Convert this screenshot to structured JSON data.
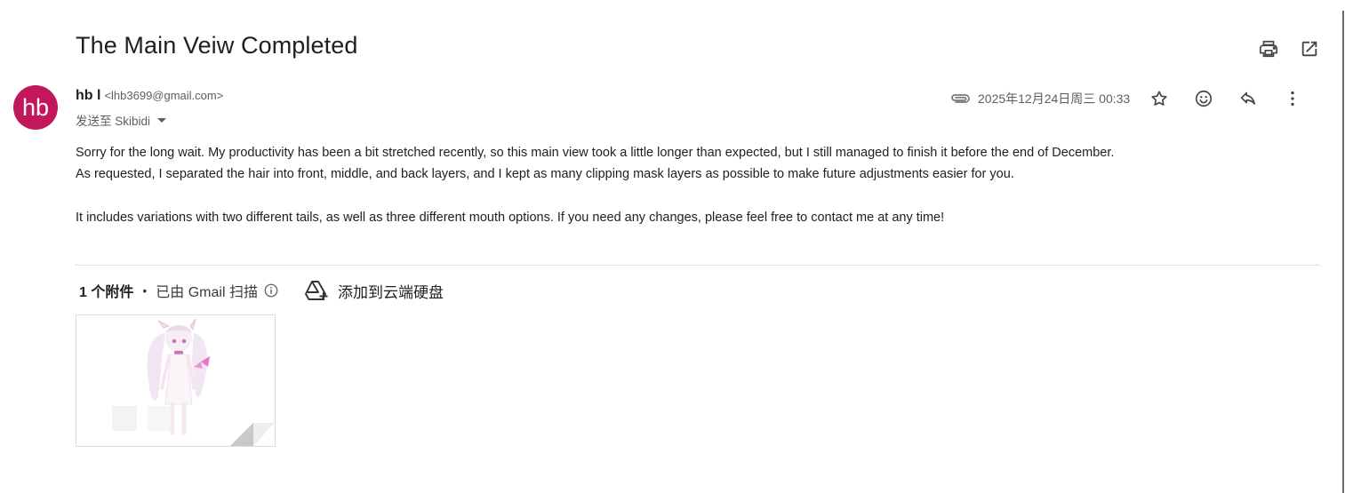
{
  "subject": "The Main Veiw Completed",
  "sender": {
    "avatar_text": "hb",
    "name": "hb l",
    "email": "<lhb3699@gmail.com>"
  },
  "recipient": "发送至 Skibidi",
  "date": "2025年12月24日周三 00:33",
  "body": {
    "line1": "Sorry for the long wait. My productivity has been a bit stretched recently, so this main view took a little longer than expected, but I still managed to finish it before the end of December.",
    "line2": "As requested, I separated the hair into front, middle, and back layers, and I kept as many clipping mask layers as possible to make future adjustments easier for you.",
    "line3": "It includes variations with two different tails, as well as three different mouth options. If you need any changes, please feel free to contact me at any time!"
  },
  "attachments": {
    "count_label": "1 个附件",
    "separator": "•",
    "scanned_label": "已由 Gmail 扫描",
    "drive_label": "添加到云端硬盘"
  },
  "icons": {
    "print": "print-icon",
    "open_new_window": "open-in-new-icon",
    "attachment": "paperclip-icon",
    "star": "star-icon",
    "emoji": "emoji-icon",
    "reply": "reply-icon",
    "more": "more-vert-icon",
    "info": "info-icon",
    "drive_add": "drive-add-icon"
  },
  "colors": {
    "avatar_bg": "#c2185b",
    "text_primary": "#1f1f1f",
    "text_secondary": "#5e5e5e"
  }
}
